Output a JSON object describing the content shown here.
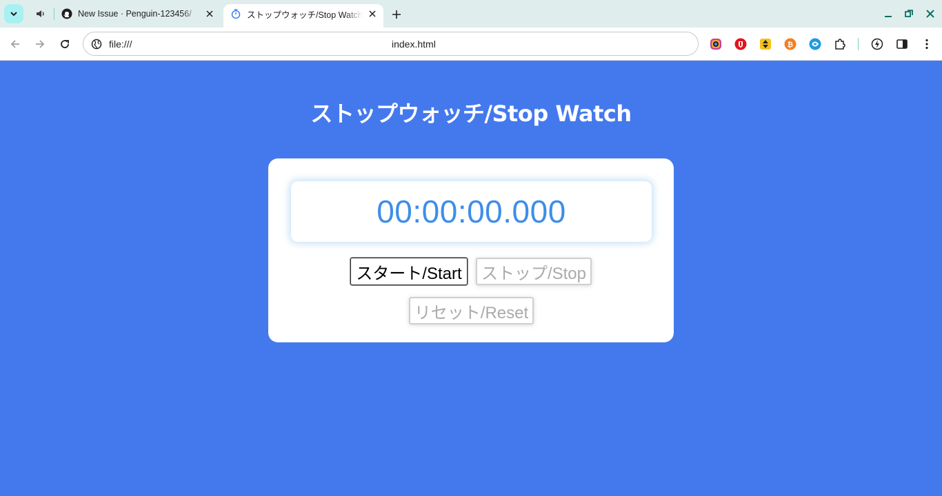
{
  "browser": {
    "tabs": [
      {
        "title": "New Issue · Penguin-123456/",
        "favicon": "github-icon",
        "audio": true
      },
      {
        "title": "ストップウォッチ/Stop Watch",
        "favicon": "stopwatch-icon",
        "active": true
      }
    ],
    "address": {
      "scheme": "file:///",
      "path": "index.html"
    },
    "colors": {
      "tabstrip": "#dfeeec",
      "accent": "#a8f1f2",
      "page_bg": "#4479ee"
    }
  },
  "app": {
    "title": "ストップウォッチ/Stop Watch",
    "time": "00:00:00.000",
    "buttons": {
      "start": "スタート/Start",
      "stop": "ストップ/Stop",
      "reset": "リセット/Reset"
    },
    "colors": {
      "time": "#3d8ee8",
      "disabled_text": "#aaaaaa"
    }
  }
}
